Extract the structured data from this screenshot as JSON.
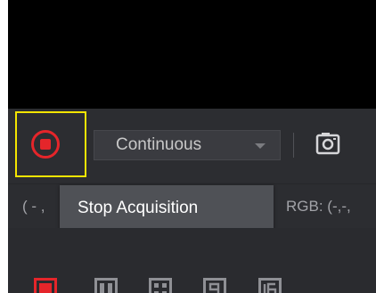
{
  "toolbar": {
    "mode_select": {
      "value": "Continuous"
    },
    "record_button_icon": "stop-record-icon",
    "snapshot_icon": "camera-icon"
  },
  "tooltip": {
    "text": "Stop Acquisition"
  },
  "status": {
    "coords_text": "( - ,",
    "rgb_text": "RGB: (-,-,"
  },
  "layout_options": [
    {
      "icon": "single-view-icon",
      "active": true
    },
    {
      "icon": "two-column-view-icon",
      "active": false
    },
    {
      "icon": "four-grid-view-icon",
      "active": false
    },
    {
      "icon": "nine-grid-view-icon",
      "active": false
    },
    {
      "icon": "sixteen-grid-view-icon",
      "active": false
    }
  ],
  "colors": {
    "accent_red": "#e5252a",
    "highlight_yellow": "#f5e500",
    "panel": "#2c2d31",
    "icon_gray": "#8f9095"
  }
}
